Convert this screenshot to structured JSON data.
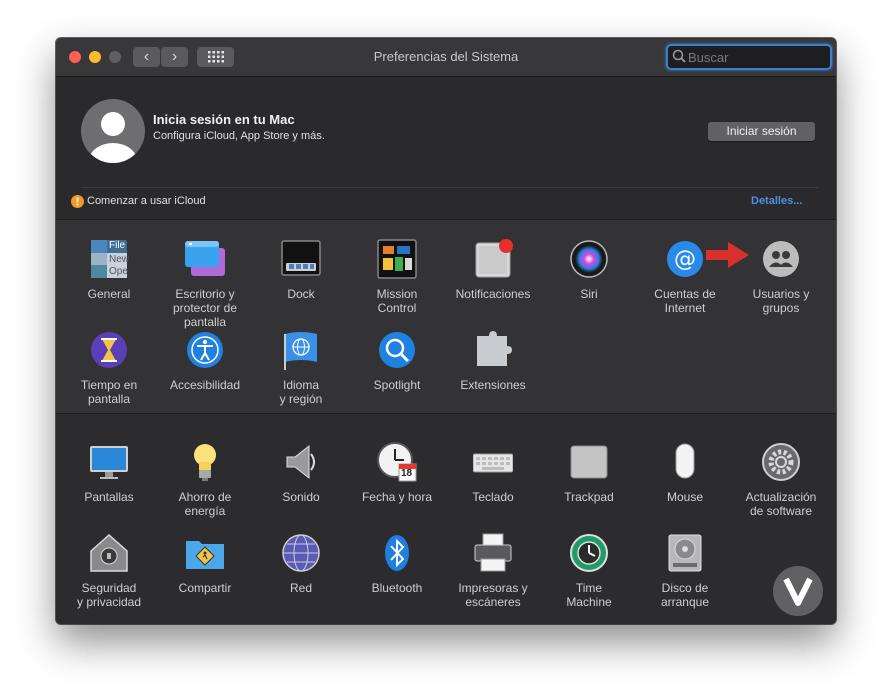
{
  "window": {
    "title": "Preferencias del Sistema",
    "search_placeholder": "Buscar"
  },
  "account": {
    "title": "Inicia sesión en tu Mac",
    "subtitle": "Configura iCloud, App Store y más.",
    "signin_label": "Iniciar sesión"
  },
  "notice": {
    "text": "Comenzar a usar iCloud",
    "details_label": "Detalles..."
  },
  "panes_row1": [
    {
      "label": "General",
      "icon": "general-icon"
    },
    {
      "label": "Escritorio y\nprotector de pantalla",
      "icon": "desktop-icon"
    },
    {
      "label": "Dock",
      "icon": "dock-icon"
    },
    {
      "label": "Mission\nControl",
      "icon": "mission-control-icon"
    },
    {
      "label": "Notificaciones",
      "icon": "notifications-icon"
    },
    {
      "label": "Siri",
      "icon": "siri-icon"
    },
    {
      "label": "Cuentas de\nInternet",
      "icon": "internet-accounts-icon"
    },
    {
      "label": "Usuarios y\ngrupos",
      "icon": "users-groups-icon"
    }
  ],
  "panes_row2": [
    {
      "label": "Tiempo en pantalla",
      "icon": "screen-time-icon"
    },
    {
      "label": "Accesibilidad",
      "icon": "accessibility-icon"
    },
    {
      "label": "Idioma\ny región",
      "icon": "language-region-icon"
    },
    {
      "label": "Spotlight",
      "icon": "spotlight-icon"
    },
    {
      "label": "Extensiones",
      "icon": "extensions-icon"
    }
  ],
  "panes_row3": [
    {
      "label": "Pantallas",
      "icon": "displays-icon"
    },
    {
      "label": "Ahorro de\nenergía",
      "icon": "energy-saver-icon"
    },
    {
      "label": "Sonido",
      "icon": "sound-icon"
    },
    {
      "label": "Fecha y hora",
      "icon": "date-time-icon"
    },
    {
      "label": "Teclado",
      "icon": "keyboard-icon"
    },
    {
      "label": "Trackpad",
      "icon": "trackpad-icon"
    },
    {
      "label": "Mouse",
      "icon": "mouse-icon"
    },
    {
      "label": "Actualización\nde software",
      "icon": "software-update-icon"
    }
  ],
  "panes_row4": [
    {
      "label": "Seguridad\ny privacidad",
      "icon": "security-privacy-icon"
    },
    {
      "label": "Compartir",
      "icon": "sharing-icon"
    },
    {
      "label": "Red",
      "icon": "network-icon"
    },
    {
      "label": "Bluetooth",
      "icon": "bluetooth-icon"
    },
    {
      "label": "Impresoras y\nescáneres",
      "icon": "printers-scanners-icon"
    },
    {
      "label": "Time\nMachine",
      "icon": "time-machine-icon"
    },
    {
      "label": "Disco de\narranque",
      "icon": "startup-disk-icon"
    }
  ],
  "icon_text": {
    "general_file": "File",
    "general_new": "New",
    "general_open": "Ope",
    "calendar_day": "18"
  },
  "colors": {
    "accent": "#4a90e2",
    "close": "#fe5f57",
    "minimize": "#febb2e",
    "zoom": "#5f5f61",
    "arrow": "#d9302c"
  }
}
